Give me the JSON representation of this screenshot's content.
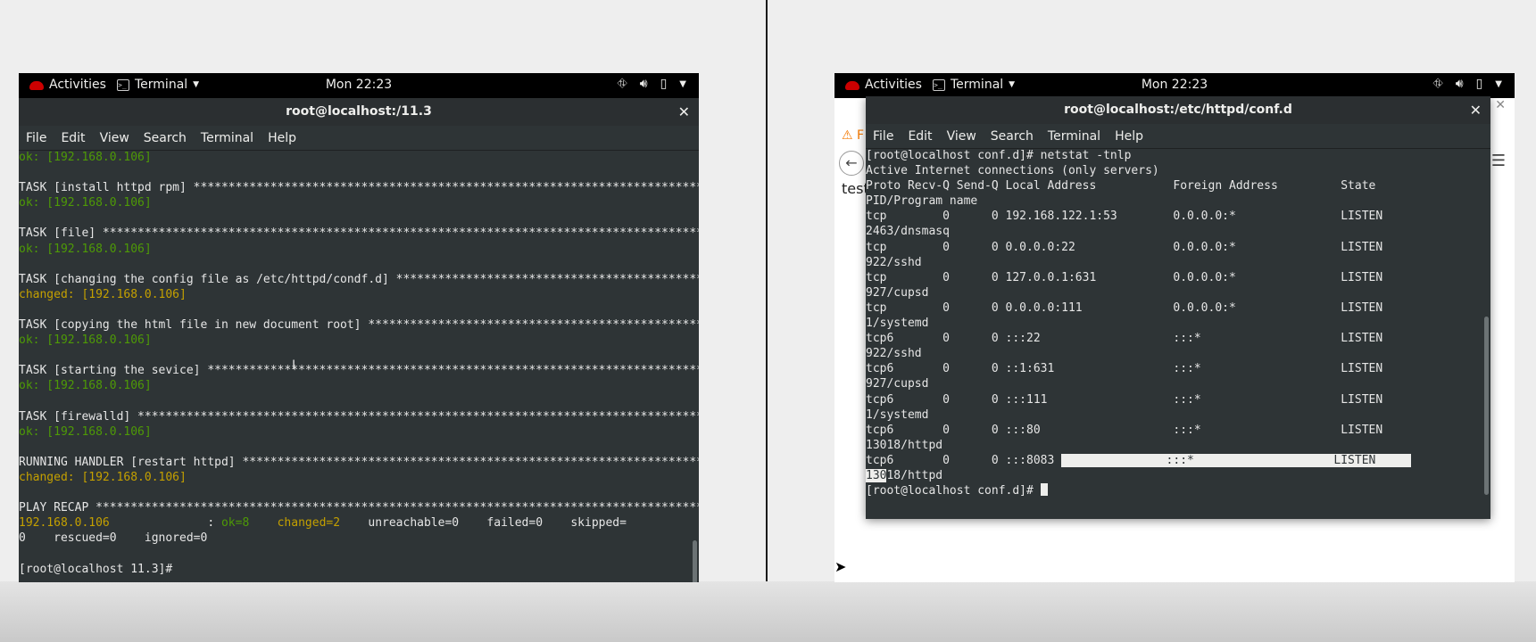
{
  "shared_topbar": {
    "activities": "Activities",
    "app_menu": "Terminal",
    "clock": "Mon 22:23"
  },
  "left": {
    "title": "root@localhost:/11.3",
    "menu": [
      "File",
      "Edit",
      "View",
      "Search",
      "Terminal",
      "Help"
    ],
    "lines": [
      {
        "segs": [
          {
            "t": "ok: [192.168.0.106]",
            "c": "green"
          }
        ]
      },
      {
        "segs": [
          {
            "t": "",
            "c": ""
          }
        ]
      },
      {
        "segs": [
          {
            "t": "TASK [install httpd rpm] ***********************************************************************************************",
            "c": ""
          }
        ]
      },
      {
        "segs": [
          {
            "t": "ok: [192.168.0.106]",
            "c": "green"
          }
        ]
      },
      {
        "segs": [
          {
            "t": "",
            "c": ""
          }
        ]
      },
      {
        "segs": [
          {
            "t": "TASK [file] ************************************************************************************************************",
            "c": ""
          }
        ]
      },
      {
        "segs": [
          {
            "t": "ok: [192.168.0.106]",
            "c": "green"
          }
        ]
      },
      {
        "segs": [
          {
            "t": "",
            "c": ""
          }
        ]
      },
      {
        "segs": [
          {
            "t": "TASK [changing the config file as /etc/httpd/condf.d] *****************************************************************",
            "c": ""
          }
        ]
      },
      {
        "segs": [
          {
            "t": "changed: [192.168.0.106]",
            "c": "yellow"
          }
        ]
      },
      {
        "segs": [
          {
            "t": "",
            "c": ""
          }
        ]
      },
      {
        "segs": [
          {
            "t": "TASK [copying the html file in new document root] *********************************************************************",
            "c": ""
          }
        ]
      },
      {
        "segs": [
          {
            "t": "ok: [192.168.0.106]",
            "c": "green"
          }
        ]
      },
      {
        "segs": [
          {
            "t": "",
            "c": ""
          }
        ]
      },
      {
        "segs": [
          {
            "t": "TASK [starting the sevice] ********************************************************************************************",
            "c": ""
          }
        ]
      },
      {
        "segs": [
          {
            "t": "ok: [192.168.0.106]",
            "c": "green"
          }
        ]
      },
      {
        "segs": [
          {
            "t": "",
            "c": ""
          }
        ]
      },
      {
        "segs": [
          {
            "t": "TASK [firewalld] *******************************************************************************************************",
            "c": ""
          }
        ]
      },
      {
        "segs": [
          {
            "t": "ok: [192.168.0.106]",
            "c": "green"
          }
        ]
      },
      {
        "segs": [
          {
            "t": "",
            "c": ""
          }
        ]
      },
      {
        "segs": [
          {
            "t": "RUNNING HANDLER [restart httpd] ****************************************************************************************",
            "c": ""
          }
        ]
      },
      {
        "segs": [
          {
            "t": "changed: [192.168.0.106]",
            "c": "yellow"
          }
        ]
      },
      {
        "segs": [
          {
            "t": "",
            "c": ""
          }
        ]
      },
      {
        "segs": [
          {
            "t": "PLAY RECAP *************************************************************************************************************",
            "c": ""
          }
        ]
      },
      {
        "segs": [
          {
            "t": "192.168.0.106",
            "c": "yellow"
          },
          {
            "t": "              : ",
            "c": ""
          },
          {
            "t": "ok=8",
            "c": "green"
          },
          {
            "t": "    ",
            "c": ""
          },
          {
            "t": "changed=2",
            "c": "yellow"
          },
          {
            "t": "    unreachable=0    failed=0    skipped=",
            "c": ""
          }
        ]
      },
      {
        "segs": [
          {
            "t": "0    rescued=0    ignored=0",
            "c": ""
          }
        ]
      },
      {
        "segs": [
          {
            "t": "",
            "c": ""
          }
        ]
      },
      {
        "segs": [
          {
            "t": "[root@localhost 11.3]# ",
            "c": ""
          }
        ]
      }
    ]
  },
  "right": {
    "title": "root@localhost:/etc/httpd/conf.d",
    "menu": [
      "File",
      "Edit",
      "View",
      "Search",
      "Terminal",
      "Help"
    ],
    "browser_partial_text": "test",
    "browser_tab_partial": "F",
    "lines": [
      "[root@localhost conf.d]# netstat -tnlp",
      "Active Internet connections (only servers)",
      "Proto Recv-Q Send-Q Local Address           Foreign Address         State",
      "PID/Program name",
      "tcp        0      0 192.168.122.1:53        0.0.0.0:*               LISTEN",
      "2463/dnsmasq",
      "tcp        0      0 0.0.0.0:22              0.0.0.0:*               LISTEN",
      "922/sshd",
      "tcp        0      0 127.0.0.1:631           0.0.0.0:*               LISTEN",
      "927/cupsd",
      "tcp        0      0 0.0.0.0:111             0.0.0.0:*               LISTEN",
      "1/systemd",
      "tcp6       0      0 :::22                   :::*                    LISTEN",
      "922/sshd",
      "tcp6       0      0 ::1:631                 :::*                    LISTEN",
      "927/cupsd",
      "tcp6       0      0 :::111                  :::*                    LISTEN",
      "1/systemd",
      "tcp6       0      0 :::80                   :::*                    LISTEN",
      "13018/httpd"
    ],
    "highlight_line": {
      "plain": "tcp6       0      0 :::8083 ",
      "selected": "               :::*                    LISTEN     "
    },
    "highlight_line2": {
      "selected": "130",
      "plain": "18/httpd"
    },
    "prompt": "[root@localhost conf.d]# "
  }
}
